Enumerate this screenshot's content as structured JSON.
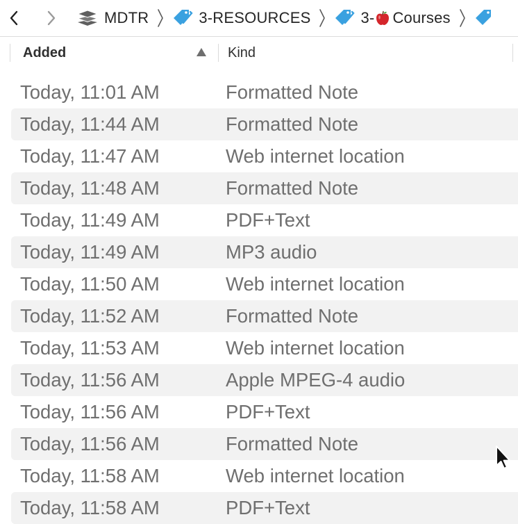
{
  "toolbar": {
    "back_icon": "chevron-left-icon",
    "forward_icon": "chevron-right-icon",
    "breadcrumbs": [
      {
        "label": "MDTR",
        "icon": "layers-stack-icon"
      },
      {
        "label": "3-RESOURCES",
        "icon": "tag-icon"
      },
      {
        "label": "3-",
        "emoji": "apple-icon",
        "suffix": "Courses",
        "icon": "tag-icon"
      }
    ]
  },
  "columns": {
    "added": "Added",
    "kind": "Kind",
    "sort": "ascending"
  },
  "rows": [
    {
      "added": "Today, 11:01 AM",
      "kind": "Formatted Note"
    },
    {
      "added": "Today, 11:44 AM",
      "kind": "Formatted Note"
    },
    {
      "added": "Today, 11:47 AM",
      "kind": "Web internet location"
    },
    {
      "added": "Today, 11:48 AM",
      "kind": "Formatted Note"
    },
    {
      "added": "Today, 11:49 AM",
      "kind": "PDF+Text"
    },
    {
      "added": "Today, 11:49 AM",
      "kind": "MP3 audio"
    },
    {
      "added": "Today, 11:50 AM",
      "kind": "Web internet location"
    },
    {
      "added": "Today, 11:52 AM",
      "kind": "Formatted Note"
    },
    {
      "added": "Today, 11:53 AM",
      "kind": "Web internet location"
    },
    {
      "added": "Today, 11:56 AM",
      "kind": "Apple MPEG-4 audio"
    },
    {
      "added": "Today, 11:56 AM",
      "kind": "PDF+Text"
    },
    {
      "added": "Today, 11:56 AM",
      "kind": "Formatted Note"
    },
    {
      "added": "Today, 11:58 AM",
      "kind": "Web internet location"
    },
    {
      "added": "Today, 11:58 AM",
      "kind": "PDF+Text"
    }
  ],
  "colors": {
    "tag_blue": "#3aa1e0",
    "stack_gray": "#5f5f5f",
    "row_alt": "#f2f2f2",
    "apple_red": "#d4262b"
  }
}
